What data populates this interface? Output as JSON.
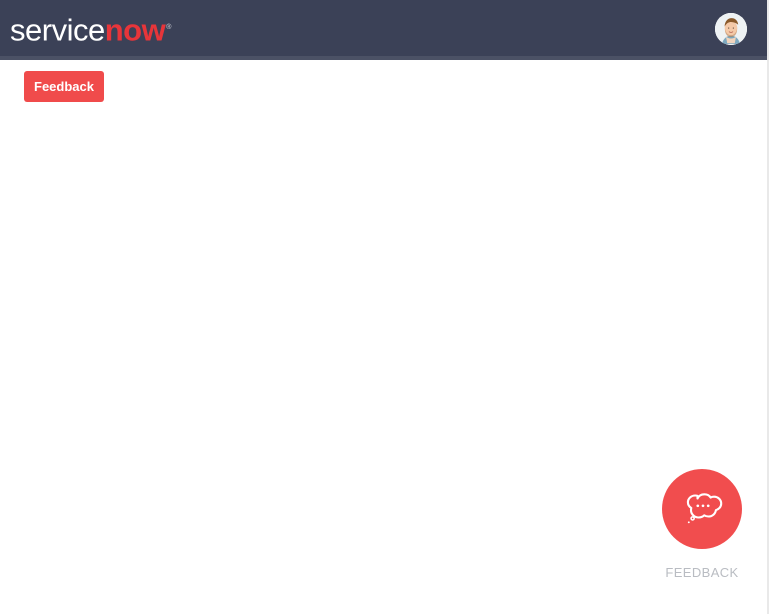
{
  "header": {
    "logo": {
      "part_1": "service",
      "part_2": "now",
      "mark": "®"
    },
    "avatar_icon": "user-avatar-icon"
  },
  "main": {
    "feedback_button_label": "Feedback"
  },
  "floating_feedback": {
    "label": "FEEDBACK",
    "icon": "thought-bubble-icon"
  },
  "colors": {
    "header_background": "#3b4157",
    "accent_red": "#f04b4b",
    "page_background": "#ffffff",
    "muted_label": "#b9bcc2"
  }
}
